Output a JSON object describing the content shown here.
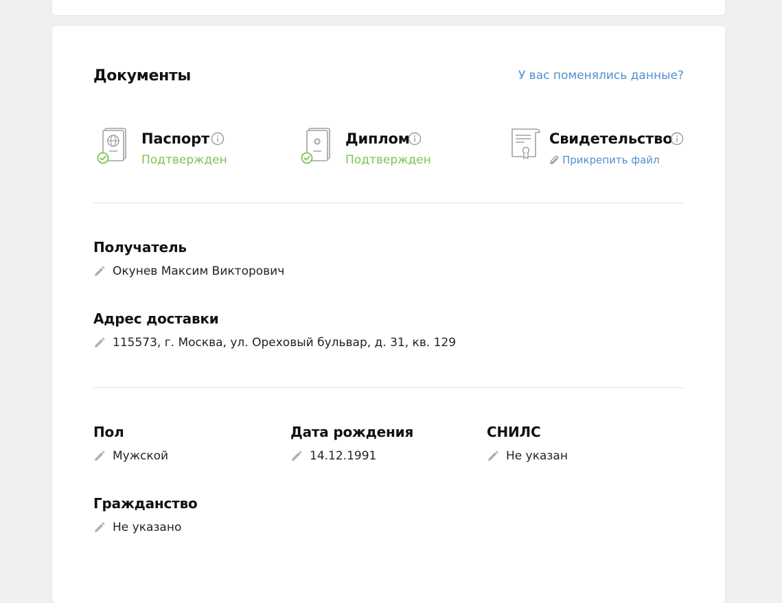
{
  "documents": {
    "title": "Документы",
    "changed_link": "У вас поменялись данные?",
    "items": [
      {
        "name": "Паспорт",
        "status": "Подтвержден",
        "icon": "passport-icon",
        "verified": true
      },
      {
        "name": "Диплом",
        "status": "Подтвержден",
        "icon": "diploma-icon",
        "verified": true
      },
      {
        "name": "Свидетельство",
        "attach_label": "Прикрепить файл",
        "icon": "certificate-icon",
        "verified": false
      }
    ]
  },
  "recipient": {
    "label": "Получатель",
    "value": "Окунев Максим Викторович"
  },
  "address": {
    "label": "Адрес доставки",
    "value": "115573, г. Москва, ул. Ореховый бульвар, д. 31, кв. 129"
  },
  "gender": {
    "label": "Пол",
    "value": "Мужской"
  },
  "birthdate": {
    "label": "Дата рождения",
    "value": "14.12.1991"
  },
  "snils": {
    "label": "СНИЛС",
    "value": "Не указан"
  },
  "citizenship": {
    "label": "Гражданство",
    "value": "Не указано"
  },
  "colors": {
    "link": "#4f8fd0",
    "success": "#7bc44f",
    "icon_gray": "#9a9a9a"
  }
}
